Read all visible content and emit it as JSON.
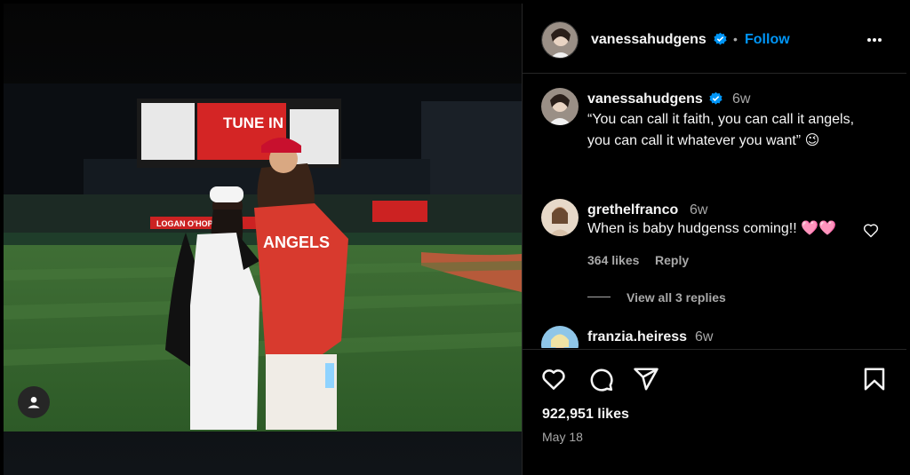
{
  "post": {
    "username": "vanessahudgens",
    "follow_label": "Follow",
    "dot": "•"
  },
  "caption": {
    "username": "vanessahudgens",
    "time": "6w",
    "text": "“You can call it faith, you can call it angels, you can call it whatever you want” 😉"
  },
  "photo": {
    "scoreboard_center": "TUNE IN",
    "jersey_text": "ANGELS",
    "banner_text": "LOGAN O'HOPPE"
  },
  "comments": [
    {
      "username": "grethelfranco",
      "time": "6w",
      "text": "When is baby hudgenss coming!! 🩷🩷",
      "likes": "364 likes",
      "reply_label": "Reply",
      "view_replies": "View all 3 replies"
    },
    {
      "username": "franzia.heiress",
      "time": "6w"
    }
  ],
  "stats": {
    "likes": "922,951 likes",
    "date": "May 18"
  },
  "icons": {
    "verified": "verified-badge-icon",
    "more": "more-options-icon",
    "like": "heart-icon",
    "comment": "comment-icon",
    "share": "share-icon",
    "save": "bookmark-icon",
    "tag": "user-tag-icon"
  },
  "colors": {
    "accent": "#0095f6",
    "background": "#000000",
    "muted": "#a8a8a8"
  }
}
